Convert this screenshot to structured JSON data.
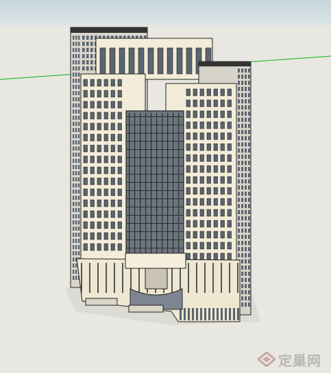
{
  "viewport": {
    "sky_color": "#cfdde1",
    "ground_color": "#e8e7e1",
    "axis_color": "#2dbb3a",
    "facade_color": "#f2ecd8",
    "glass_color": "#5b6570",
    "curtain_wall_color": "#6d757d"
  },
  "model": {
    "subject": "high-rise-office-tower"
  },
  "watermark": {
    "text": "定巢网",
    "icon": "logo-diamond-icon",
    "color": "#b9b7b3"
  }
}
